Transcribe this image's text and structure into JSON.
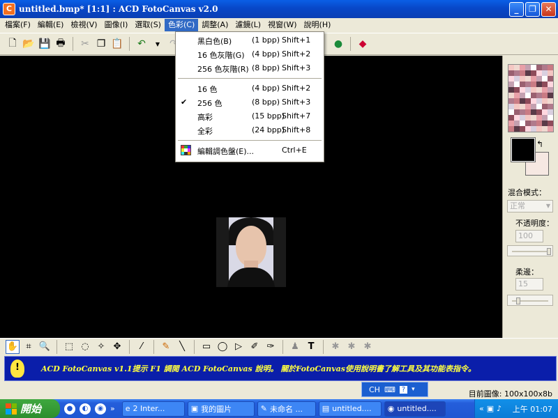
{
  "window": {
    "title": "untitled.bmp* [1:1] : ACD FotoCanvas v2.0",
    "min": "_",
    "max": "❐",
    "close": "✕"
  },
  "menubar": {
    "items": [
      "檔案(F)",
      "編輯(E)",
      "檢視(V)",
      "圖像(I)",
      "選取(S)",
      "色彩(C)",
      "調整(A)",
      "濾鏡(L)",
      "視窗(W)",
      "說明(H)"
    ],
    "active_index": 5
  },
  "color_menu": {
    "items": [
      {
        "label": "黑白色(B)",
        "bpp": "(1 bpp)",
        "shortcut": "Shift+1",
        "checked": false
      },
      {
        "label": "16 色灰階(G)",
        "bpp": "(4 bpp)",
        "shortcut": "Shift+2",
        "checked": false
      },
      {
        "label": "256 色灰階(R)",
        "bpp": "(8 bpp)",
        "shortcut": "Shift+3",
        "checked": false
      },
      {
        "label": "16 色",
        "bpp": "(4 bpp)",
        "shortcut": "Shift+2",
        "checked": false
      },
      {
        "label": "256 色",
        "bpp": "(8 bpp)",
        "shortcut": "Shift+3",
        "checked": true
      },
      {
        "label": "高彩",
        "bpp": "(15 bpp)",
        "shortcut": "Shift+7",
        "checked": false
      },
      {
        "label": "全彩",
        "bpp": "(24 bpp)",
        "shortcut": "Shift+8",
        "checked": false
      },
      {
        "label": "編輯調色盤(E)...",
        "bpp": "",
        "shortcut": "Ctrl+E",
        "checked": false
      }
    ],
    "checkmark": "✔"
  },
  "right_panel": {
    "blend_label": "混合模式：",
    "blend_value": "正常",
    "opacity_label": "不透明度：",
    "opacity_value": "100",
    "opacity_level": 1.0,
    "soft_edge_label": "柔邊：",
    "soft_edge_value": "15",
    "soft_edge_level": 0.15,
    "swap_icon": "↰"
  },
  "info": {
    "bulb": "!",
    "text": "ACD FotoCanvas v1.1提示 F1 調閱 ACD FotoCanvas 說明。 關於FotoCanvas使用說明書了解工具及其功能表指令。"
  },
  "status": {
    "text": "目前圖像: 100x100x8b"
  },
  "langbar": {
    "lang": "CH",
    "help": "?"
  },
  "taskbar": {
    "start_label": "開始",
    "tasks": [
      {
        "label": "2 Inter...",
        "icon": "e"
      },
      {
        "label": "我的圖片",
        "icon": "▣"
      },
      {
        "label": "未命名 ...",
        "icon": "✎"
      },
      {
        "label": "untitled....",
        "icon": "▤"
      },
      {
        "label": "untitled....",
        "icon": "◉"
      }
    ],
    "clock": "上午 01:07",
    "quicklaunch_chevron": "»"
  },
  "colors": {
    "accent": "#316ac5",
    "titlebar": "#0a48c8",
    "info_bg": "#0a1eaa",
    "info_text": "#ffff40"
  }
}
